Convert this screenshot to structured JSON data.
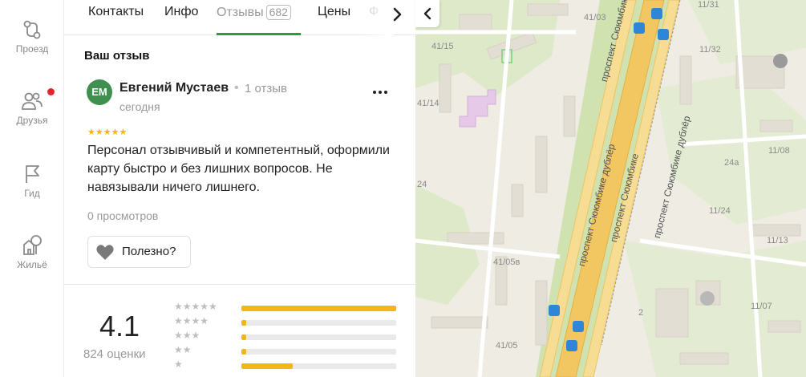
{
  "rail": {
    "items": [
      {
        "label": "Проезд",
        "icon": "route-icon"
      },
      {
        "label": "Друзья",
        "icon": "friends-icon"
      },
      {
        "label": "Гид",
        "icon": "flag-icon"
      },
      {
        "label": "Жильё",
        "icon": "house-tree-icon"
      }
    ]
  },
  "tabs": [
    {
      "label": "Контакты"
    },
    {
      "label": "Инфо"
    },
    {
      "label": "Отзывы",
      "badge": "682",
      "active": true
    },
    {
      "label": "Цены"
    },
    {
      "label": "Ф"
    }
  ],
  "review": {
    "section_title": "Ваш отзыв",
    "avatar_initials": "ЕМ",
    "author": "Евгений Мустаев",
    "author_separator": "•",
    "author_reviews": "1 отзыв",
    "date": "сегодня",
    "stars": 5,
    "stars_text": "★★★★★",
    "text": "Персонал отзывчивый и компетентный, оформили карту быстро и без лишних вопросов. Не навязывали ничего лишнего.",
    "views": "0 просмотров",
    "useful_label": "Полезно?"
  },
  "rating": {
    "value": "4.1",
    "count_label": "824 оценки",
    "distribution": [
      {
        "stars": "★★★★★",
        "fraction": 1.0
      },
      {
        "stars": "★★★★",
        "fraction": 0.03
      },
      {
        "stars": "★★★",
        "fraction": 0.03
      },
      {
        "stars": "★★",
        "fraction": 0.03
      },
      {
        "stars": "★",
        "fraction": 0.33
      }
    ]
  },
  "map": {
    "labels": [
      "41/03",
      "41/15",
      "41/14",
      "24",
      "41/05в",
      "41/05",
      "2",
      "11/31",
      "11/32",
      "11/08",
      "24а",
      "11/24",
      "11/13",
      "11/07"
    ],
    "streets": [
      "проспект Сююмбике",
      "проспект Сююмбике дублёр",
      "проспект Сююмбике дублёр",
      "проспект Сююмбике"
    ]
  }
}
